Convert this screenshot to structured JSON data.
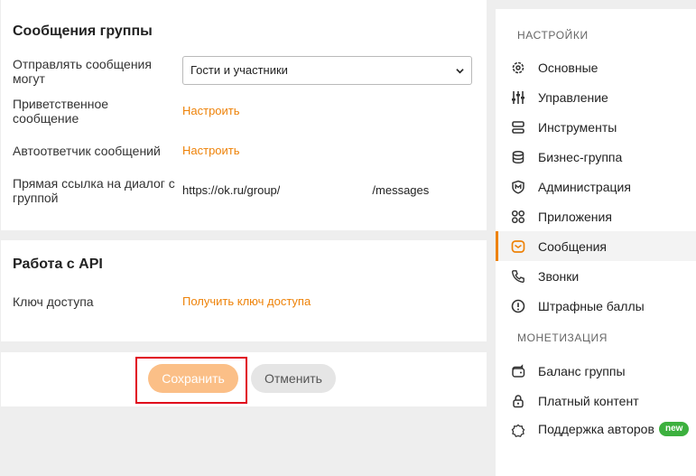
{
  "messages_card": {
    "title": "Сообщения группы",
    "send_label": "Отправлять сообщения могут",
    "send_value": "Гости и участники",
    "welcome_label": "Приветственное сообщение",
    "welcome_link": "Настроить",
    "autoreply_label": "Автоответчик сообщений",
    "autoreply_link": "Настроить",
    "direct_label": "Прямая ссылка на диалог с группой",
    "direct_prefix": "https://ok.ru/group/",
    "direct_suffix": "/messages"
  },
  "api_card": {
    "title": "Работа с API",
    "key_label": "Ключ доступа",
    "key_link": "Получить ключ доступа"
  },
  "actions": {
    "save_label": "Сохранить",
    "cancel_label": "Отменить"
  },
  "sidebar": {
    "settings_header": "НАСТРОЙКИ",
    "items": [
      {
        "label": "Основные",
        "icon": "gear-icon"
      },
      {
        "label": "Управление",
        "icon": "sliders-icon"
      },
      {
        "label": "Инструменты",
        "icon": "tools-icon"
      },
      {
        "label": "Бизнес-группа",
        "icon": "database-icon"
      },
      {
        "label": "Администрация",
        "icon": "shield-icon"
      },
      {
        "label": "Приложения",
        "icon": "apps-grid-icon"
      },
      {
        "label": "Сообщения",
        "icon": "message-icon"
      },
      {
        "label": "Звонки",
        "icon": "phone-icon"
      },
      {
        "label": "Штрафные баллы",
        "icon": "alert-circle-icon"
      }
    ],
    "monetization_header": "МОНЕТИЗАЦИЯ",
    "money_items": [
      {
        "label": "Баланс группы",
        "icon": "wallet-icon"
      },
      {
        "label": "Платный контент",
        "icon": "lock-icon"
      },
      {
        "label": "Поддержка авторов",
        "icon": "badge-icon",
        "badge": "new"
      }
    ],
    "active_color": "#ee8208"
  }
}
